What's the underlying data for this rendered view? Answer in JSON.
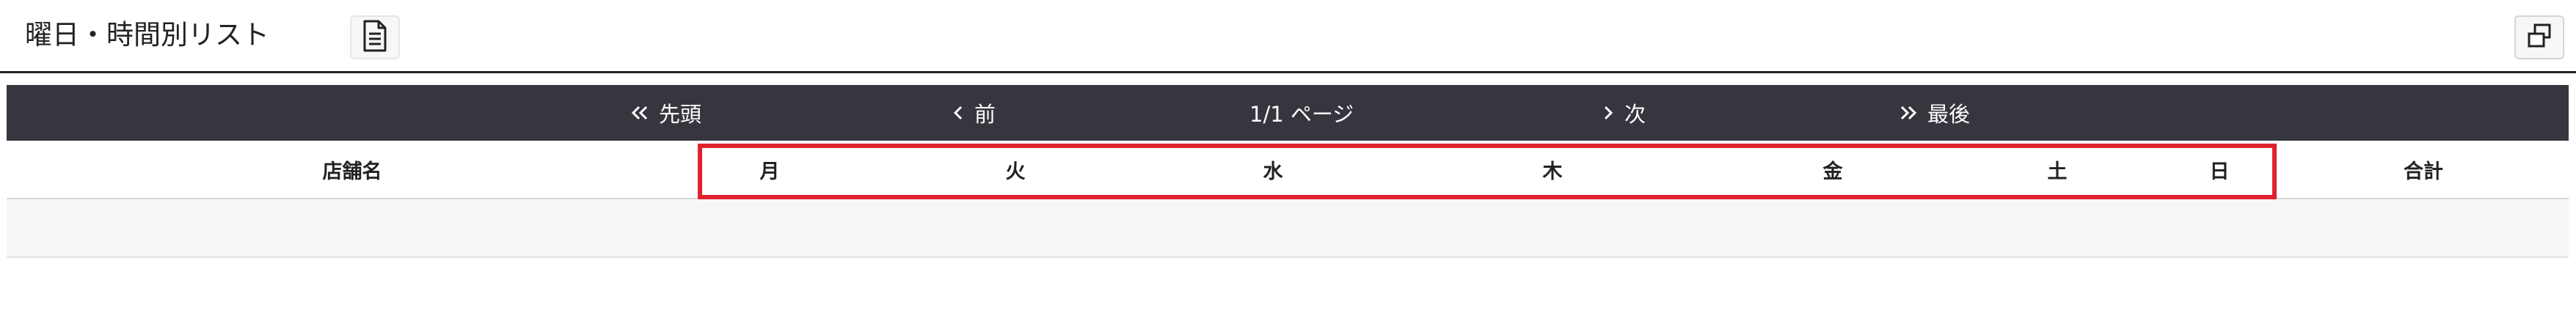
{
  "header": {
    "title": "曜日・時間別リスト",
    "doc_icon": "document-icon",
    "window_icon": "window-restore-icon"
  },
  "pager": {
    "first_label": "先頭",
    "prev_label": "前",
    "page_info": "1/1 ページ",
    "next_label": "次",
    "last_label": "最後"
  },
  "table": {
    "columns": {
      "store": "店舗名",
      "mon": "月",
      "tue": "火",
      "wed": "水",
      "thu": "木",
      "fri": "金",
      "sat": "土",
      "sun": "日",
      "total": "合計"
    },
    "rows": []
  },
  "colors": {
    "pager_bg": "#36363f",
    "highlight": "#e0222f",
    "row_bg": "#f6f6f6"
  }
}
